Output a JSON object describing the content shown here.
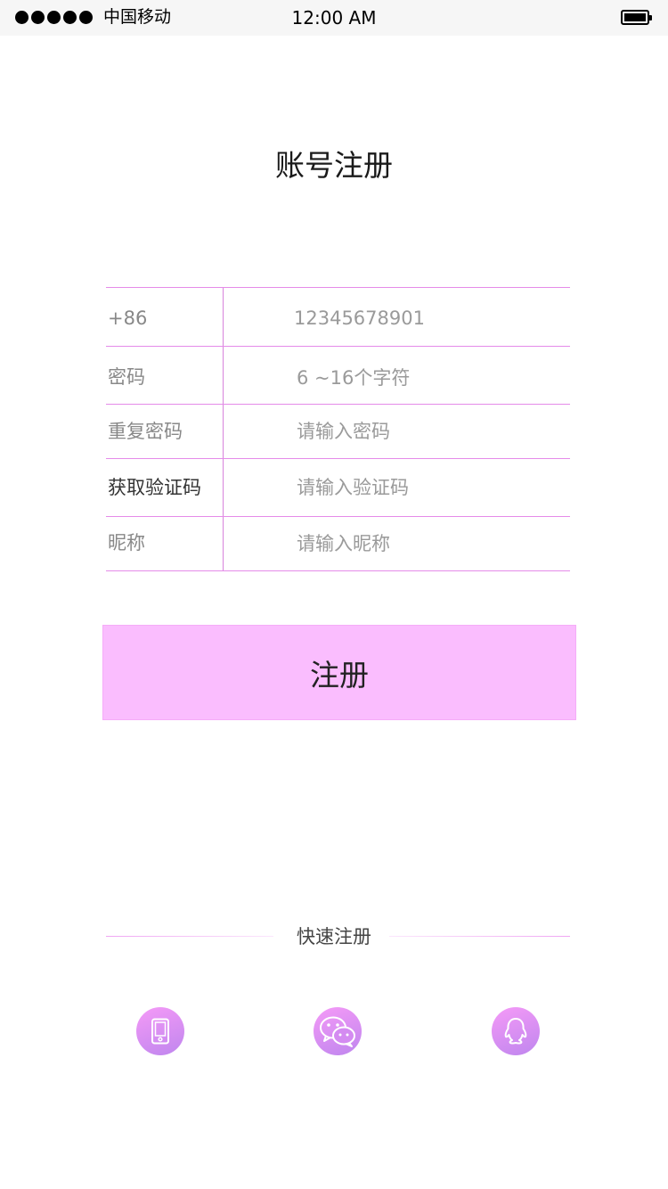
{
  "status_bar": {
    "carrier": "中国移动",
    "time": "12:00 AM",
    "signal_icon": "signal-dots-icon",
    "battery_icon": "battery-icon"
  },
  "title": "账号注册",
  "form": {
    "rows": [
      {
        "label": "+86",
        "value": "12345678901",
        "kind": "value"
      },
      {
        "label": "密码",
        "value": "6 ~16个字符",
        "kind": "placeholder"
      },
      {
        "label": "重复密码",
        "value": "请输入密码",
        "kind": "placeholder"
      },
      {
        "label": "获取验证码",
        "value": "请输入验证码",
        "kind": "placeholder"
      },
      {
        "label": "昵称",
        "value": "请输入昵称",
        "kind": "placeholder"
      }
    ]
  },
  "register_button": {
    "label": "注册"
  },
  "quick_register": {
    "label": "快速注册",
    "icons": [
      "phone-icon",
      "wechat-icon",
      "qq-icon"
    ]
  },
  "colors": {
    "accent": "#fabdfe",
    "divider": "#e58be9",
    "icon_gradient_start": "#f59af7",
    "icon_gradient_end": "#bf86ee"
  }
}
